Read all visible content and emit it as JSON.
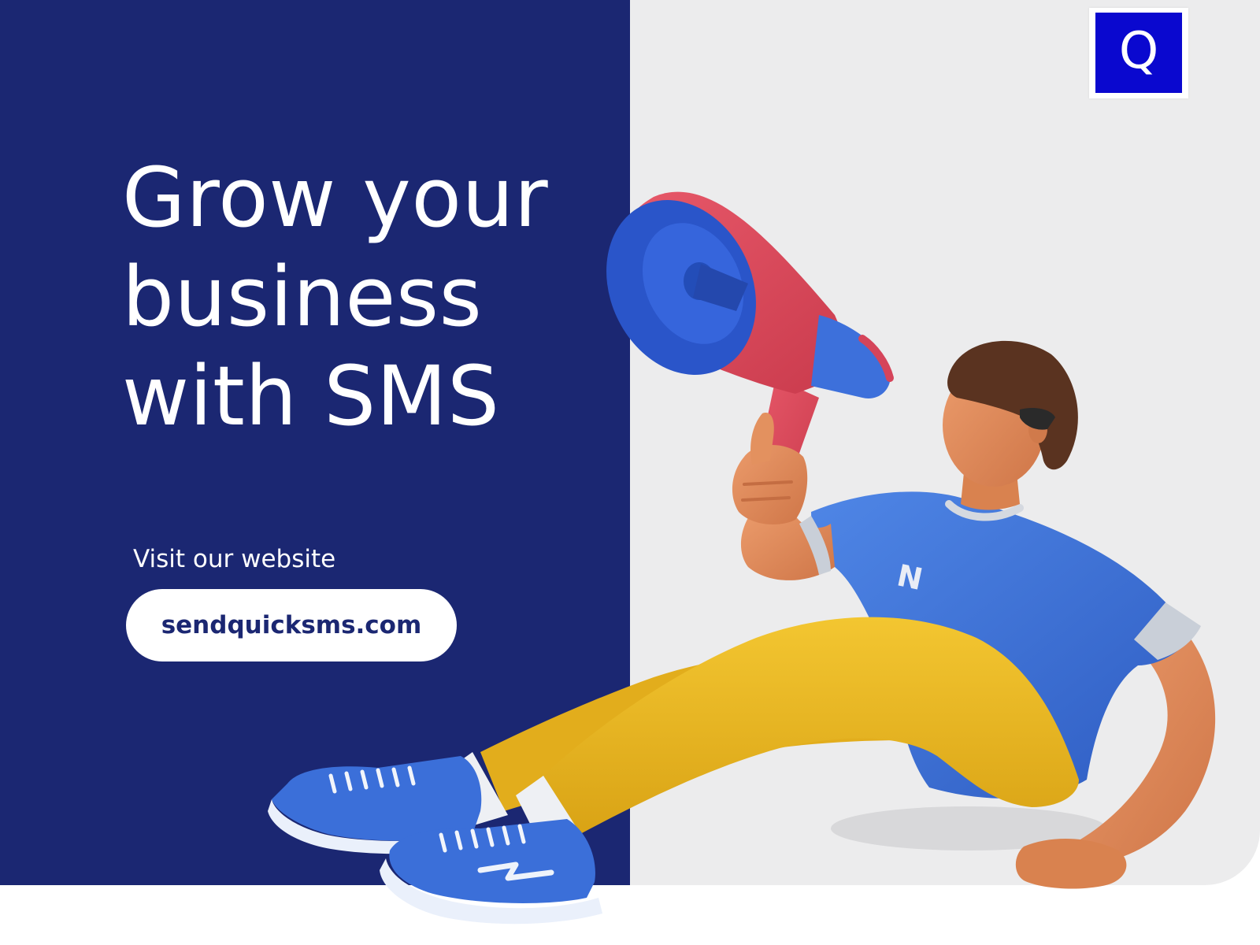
{
  "logo": {
    "letter": "Q",
    "icon": "q-logo-icon",
    "color": "#0a08cf"
  },
  "headline": {
    "lines": [
      "Grow your",
      "business",
      "with SMS"
    ]
  },
  "cta": {
    "label": "Visit our website",
    "url": "sendquicksms.com"
  },
  "colors": {
    "blue_panel": "#1b2772",
    "grey_panel": "#ececed",
    "shirt": "#3a6fd6",
    "pants": "#e7b51e",
    "megaphone": "#df4a5a",
    "shoes": "#3b6fd9",
    "skin": "#e08c5c",
    "hair": "#5a3320"
  },
  "illustration": {
    "subject": "person-with-megaphone",
    "shirt_letter": "N"
  }
}
